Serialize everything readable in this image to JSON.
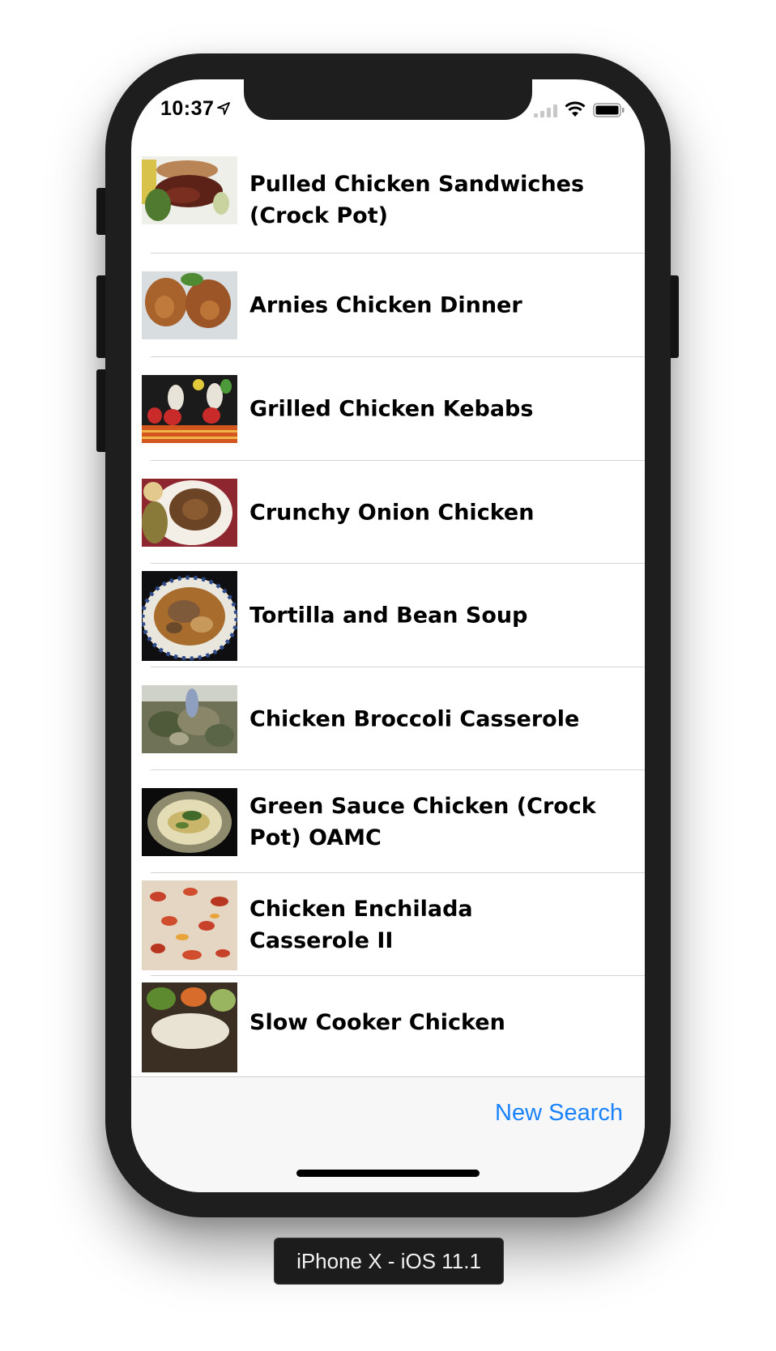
{
  "status_bar": {
    "time": "10:37"
  },
  "recipes": [
    {
      "title": "Pulled Chicken Sandwiches (Crock Pot)",
      "thumbnail": "pulled-chicken-photo"
    },
    {
      "title": "Arnies Chicken Dinner",
      "thumbnail": "fried-chicken-photo"
    },
    {
      "title": "Grilled Chicken Kebabs",
      "thumbnail": "kebabs-photo"
    },
    {
      "title": "Crunchy Onion Chicken",
      "thumbnail": "onion-chicken-photo"
    },
    {
      "title": "Tortilla and Bean Soup",
      "thumbnail": "soup-photo"
    },
    {
      "title": "Chicken Broccoli Casserole",
      "thumbnail": "casserole-photo"
    },
    {
      "title": "Green Sauce Chicken (Crock Pot) OAMC",
      "thumbnail": "green-sauce-photo"
    },
    {
      "title": "Chicken Enchilada Casserole II",
      "thumbnail": "enchilada-photo"
    },
    {
      "title": "Slow Cooker Chicken",
      "thumbnail": "slow-cooker-photo"
    }
  ],
  "toolbar": {
    "new_search_label": "New Search"
  },
  "device_label": "iPhone X - iOS 11.1",
  "colors": {
    "accent": "#1a82fb",
    "separator": "#d4d4d6",
    "toolbar_bg": "#f7f7f7",
    "bezel": "#1e1e1f"
  }
}
